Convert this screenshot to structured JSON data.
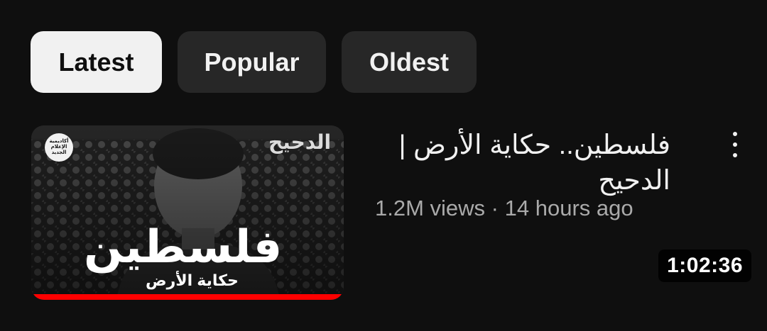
{
  "filters": {
    "latest": "Latest",
    "popular": "Popular",
    "oldest": "Oldest"
  },
  "video": {
    "title": "فلسطين.. حكاية الأرض | الدحيح",
    "views": "1.2M views",
    "separator": "·",
    "age": "14 hours ago",
    "duration": "1:02:36",
    "progress_fraction": 1.0,
    "thumbnail": {
      "overlay_title": "فلسطين",
      "overlay_subtitle": "حكاية الأرض",
      "brand": "الدحيح",
      "badge_text": "أكاديمية الإعلام الجديد"
    }
  },
  "colors": {
    "background": "#0f0f0f",
    "chip": "#272727",
    "chip_active": "#f1f1f1",
    "progress": "#ff0000",
    "meta_text": "#aaaaaa"
  },
  "icons": {
    "more": "more-vertical-icon"
  }
}
